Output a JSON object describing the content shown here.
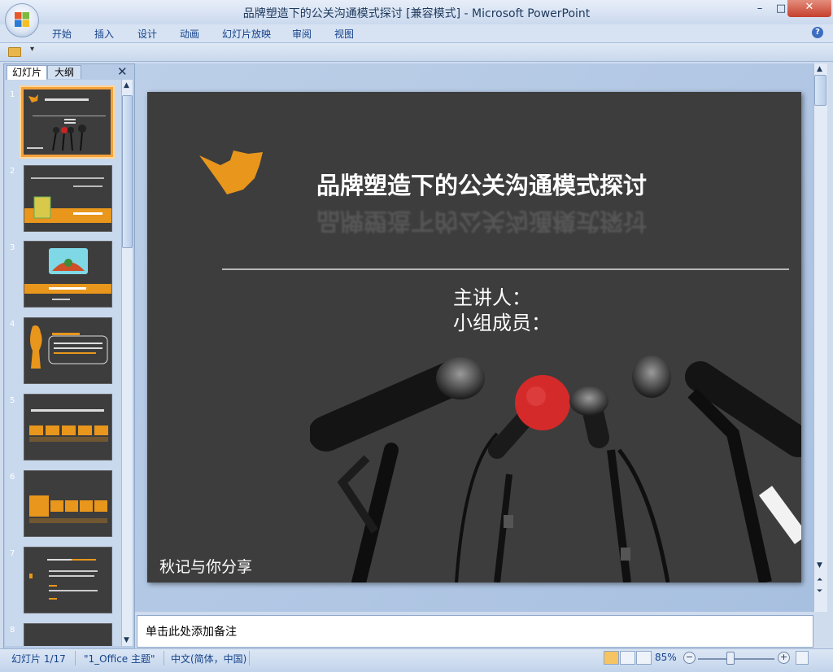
{
  "window": {
    "title": "品牌塑造下的公关沟通模式探讨 [兼容模式] - Microsoft PowerPoint",
    "minimize": "–",
    "restore": "□",
    "close": "✕"
  },
  "ribbon": {
    "tabs": [
      "开始",
      "插入",
      "设计",
      "动画",
      "幻灯片放映",
      "审阅",
      "视图"
    ],
    "help": "?"
  },
  "quick_access": {
    "dropdown": "▾"
  },
  "left_pane": {
    "tab_slides": "幻灯片",
    "tab_outline": "大纲",
    "close": "✕",
    "slides": [
      {
        "num": "1",
        "selected": true
      },
      {
        "num": "2",
        "selected": false
      },
      {
        "num": "3",
        "selected": false
      },
      {
        "num": "4",
        "selected": false
      },
      {
        "num": "5",
        "selected": false
      },
      {
        "num": "6",
        "selected": false
      },
      {
        "num": "7",
        "selected": false
      },
      {
        "num": "8",
        "selected": false
      }
    ]
  },
  "slide": {
    "title": "品牌塑造下的公关沟通模式探讨",
    "speaker": "主讲人：",
    "members": "小组成员：",
    "footer": "秋记与你分享",
    "accent": "#e8961c",
    "mic_red": "#d42a2a"
  },
  "notes": {
    "placeholder": "单击此处添加备注"
  },
  "status": {
    "slide_counter": "幻灯片 1/17",
    "theme": "\"1_Office 主题\"",
    "language": "中文(简体，中国)",
    "zoom": "85%"
  }
}
